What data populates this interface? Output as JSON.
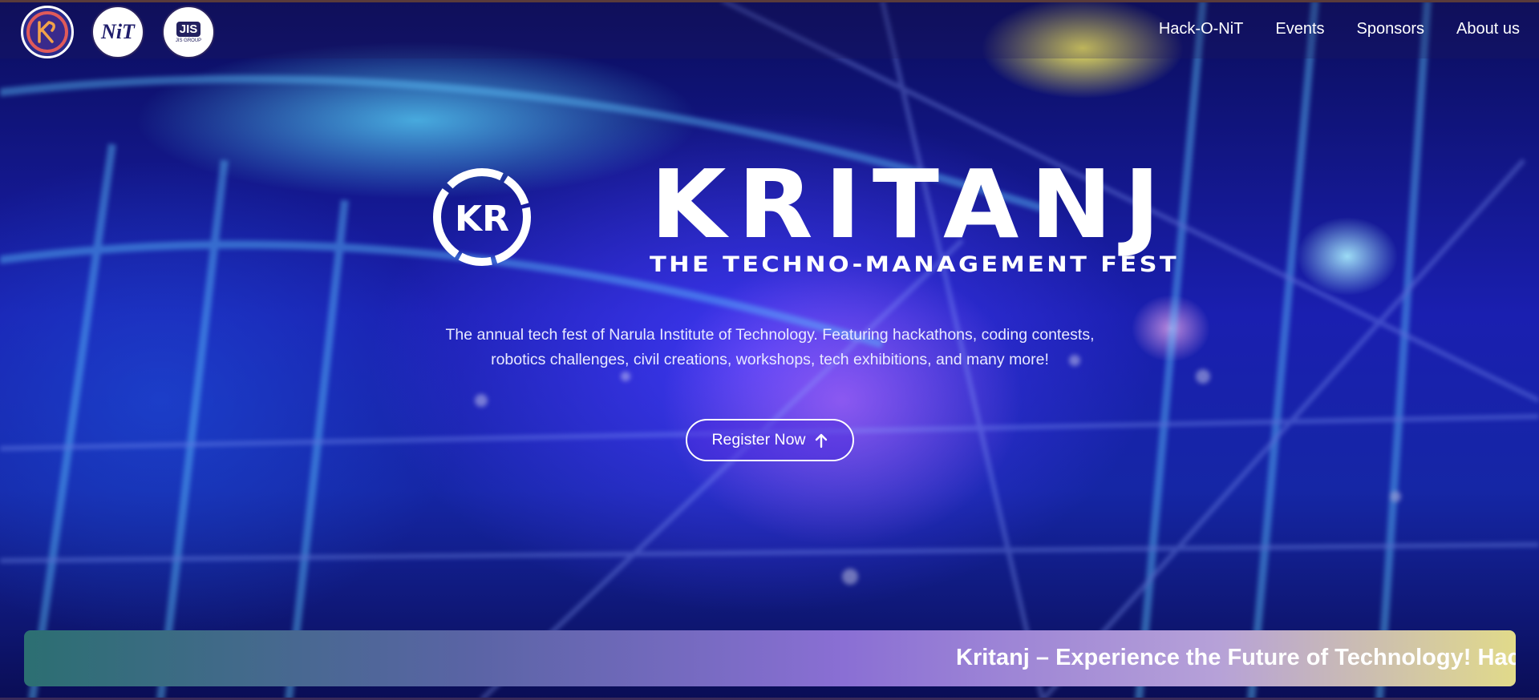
{
  "logos": {
    "kritanj_alt": "KR",
    "nit_text": "NiT",
    "jis_text": "JIS",
    "jis_subtext": "JIS GROUP"
  },
  "nav": {
    "items": [
      {
        "label": "Hack-O-NiT"
      },
      {
        "label": "Events"
      },
      {
        "label": "Sponsors"
      },
      {
        "label": "About us"
      }
    ]
  },
  "hero": {
    "emblem_letters": "KR",
    "title": "KRITANJ",
    "subtitle": "THE TECHNO-MANAGEMENT FEST",
    "description": "The annual tech fest of Narula Institute of Technology. Featuring hackathons, coding contests, robotics challenges, civil creations, workshops, tech exhibitions, and many more!",
    "register_label": "Register Now"
  },
  "marquee": {
    "text": "Kritanj – Experience the Future of Technology! Hack-O-NiT"
  },
  "colors": {
    "accent": "#4f2ee0",
    "marquee_start": "#2c6f72",
    "marquee_end": "#e1da8a"
  }
}
